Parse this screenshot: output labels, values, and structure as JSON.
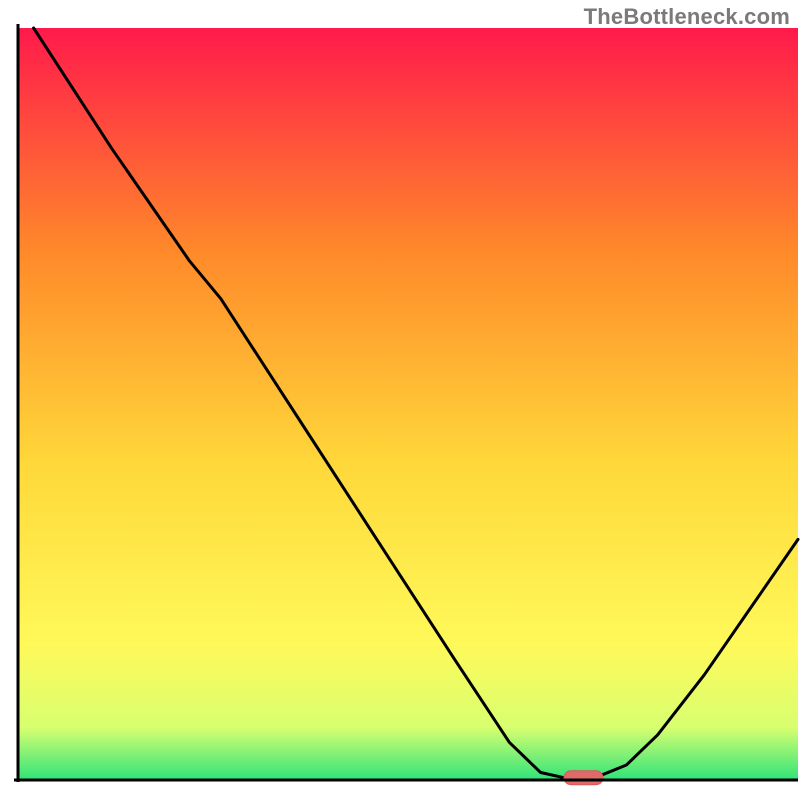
{
  "attribution": "TheBottleneck.com",
  "colors": {
    "gradient_top": "#ff1a4b",
    "gradient_mid_upper": "#ff8a2a",
    "gradient_mid": "#ffd83a",
    "gradient_mid_lower": "#fff95a",
    "gradient_near_bottom": "#d8ff70",
    "gradient_bottom": "#2fe37a",
    "axis": "#000000",
    "curve": "#000000",
    "marker_fill": "#e06a6a",
    "marker_stroke": "#d85858"
  },
  "chart_data": {
    "type": "line",
    "title": "",
    "xlabel": "",
    "ylabel": "",
    "xlim": [
      0,
      100
    ],
    "ylim": [
      0,
      100
    ],
    "legend": false,
    "grid": false,
    "curve": [
      {
        "x": 2,
        "y": 100
      },
      {
        "x": 12,
        "y": 84
      },
      {
        "x": 22,
        "y": 69
      },
      {
        "x": 26,
        "y": 64
      },
      {
        "x": 36,
        "y": 48
      },
      {
        "x": 46,
        "y": 32
      },
      {
        "x": 56,
        "y": 16
      },
      {
        "x": 63,
        "y": 5
      },
      {
        "x": 67,
        "y": 1
      },
      {
        "x": 70,
        "y": 0.3
      },
      {
        "x": 74,
        "y": 0.3
      },
      {
        "x": 78,
        "y": 2
      },
      {
        "x": 82,
        "y": 6
      },
      {
        "x": 88,
        "y": 14
      },
      {
        "x": 94,
        "y": 23
      },
      {
        "x": 100,
        "y": 32
      }
    ],
    "marker": {
      "x_start": 70,
      "x_end": 75,
      "y": 0.3
    }
  }
}
